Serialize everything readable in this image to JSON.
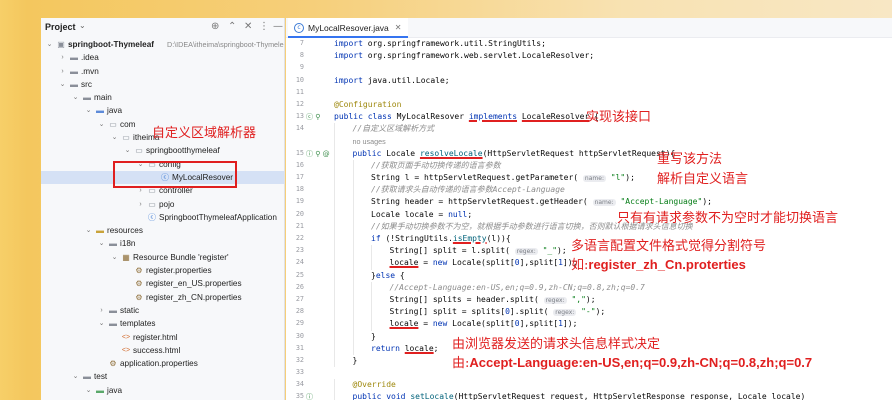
{
  "project_panel": {
    "title": "Project",
    "title_chevron": "chevron-down",
    "tools": [
      "⊕",
      "⌃",
      "✕",
      "⋮",
      "—"
    ],
    "tree": [
      {
        "label": "springboot-Thymeleaf",
        "path": "D:\\IDEA\\itheima\\springboot-Thymeleaf",
        "depth": 0,
        "arrow": "open",
        "icon": "module",
        "bold": true
      },
      {
        "label": ".idea",
        "depth": 1,
        "arrow": "closed",
        "icon": "folder"
      },
      {
        "label": ".mvn",
        "depth": 1,
        "arrow": "closed",
        "icon": "folder"
      },
      {
        "label": "src",
        "depth": 1,
        "arrow": "open",
        "icon": "folder"
      },
      {
        "label": "main",
        "depth": 2,
        "arrow": "open",
        "icon": "folder"
      },
      {
        "label": "java",
        "depth": 3,
        "arrow": "open",
        "icon": "src"
      },
      {
        "label": "com",
        "depth": 4,
        "arrow": "open",
        "icon": "pkg"
      },
      {
        "label": "itheima",
        "depth": 5,
        "arrow": "open",
        "icon": "pkg"
      },
      {
        "label": "springbootthymeleaf",
        "depth": 6,
        "arrow": "open",
        "icon": "pkg"
      },
      {
        "label": "config",
        "depth": 7,
        "arrow": "open",
        "icon": "pkg"
      },
      {
        "label": "MyLocalResover",
        "depth": 8,
        "arrow": "",
        "icon": "cls",
        "selected": true
      },
      {
        "label": "controller",
        "depth": 7,
        "arrow": "closed",
        "icon": "pkg"
      },
      {
        "label": "pojo",
        "depth": 7,
        "arrow": "closed",
        "icon": "pkg"
      },
      {
        "label": "SpringbootThymeleafApplication",
        "depth": 7,
        "arrow": "",
        "icon": "cls"
      },
      {
        "label": "resources",
        "depth": 3,
        "arrow": "open",
        "icon": "res"
      },
      {
        "label": "i18n",
        "depth": 4,
        "arrow": "open",
        "icon": "folder"
      },
      {
        "label": "Resource Bundle 'register'",
        "depth": 5,
        "arrow": "open",
        "icon": "bundle"
      },
      {
        "label": "register.properties",
        "depth": 6,
        "arrow": "",
        "icon": "props"
      },
      {
        "label": "register_en_US.properties",
        "depth": 6,
        "arrow": "",
        "icon": "props"
      },
      {
        "label": "register_zh_CN.properties",
        "depth": 6,
        "arrow": "",
        "icon": "props"
      },
      {
        "label": "static",
        "depth": 4,
        "arrow": "closed",
        "icon": "folder"
      },
      {
        "label": "templates",
        "depth": 4,
        "arrow": "open",
        "icon": "folder"
      },
      {
        "label": "register.html",
        "depth": 5,
        "arrow": "",
        "icon": "html"
      },
      {
        "label": "success.html",
        "depth": 5,
        "arrow": "",
        "icon": "html"
      },
      {
        "label": "application.properties",
        "depth": 4,
        "arrow": "",
        "icon": "props"
      },
      {
        "label": "test",
        "depth": 2,
        "arrow": "open",
        "icon": "folder"
      },
      {
        "label": "java",
        "depth": 3,
        "arrow": "open",
        "icon": "test"
      }
    ]
  },
  "editor": {
    "tab_label": "MyLocalResover.java",
    "lines": [
      {
        "n": "7",
        "ind": 0,
        "html": "<span class='kw'>import</span> org.springframework.util.StringUtils;"
      },
      {
        "n": "8",
        "ind": 0,
        "html": "<span class='kw'>import</span> org.springframework.web.servlet.LocaleResolver;"
      },
      {
        "n": "9",
        "ind": 0,
        "html": ""
      },
      {
        "n": "10",
        "ind": 0,
        "html": "<span class='kw'>import</span> java.util.Locale;"
      },
      {
        "n": "11",
        "ind": 0,
        "html": ""
      },
      {
        "n": "12",
        "ind": 0,
        "html": "<span class='an'>@Configuration</span>"
      },
      {
        "n": "13",
        "ind": 0,
        "gut": "ⓒ ⚲",
        "html": "<span class='kw'>public class</span> MyLocalResover <span class='kw red-ul'>implements</span> <span class='red-ul'>LocaleResolver</span> {"
      },
      {
        "n": "14",
        "ind": 1,
        "html": "<span class='cm'>//自定义区域解析方式</span>"
      },
      {
        "n": "",
        "ind": 1,
        "html": "<span class='uses'>no usages</span>"
      },
      {
        "n": "15",
        "ind": 1,
        "gut": "ⓘ ⚲ @",
        "html": "<span class='kw'>public</span> Locale <span class='meth red-ul'>resolveLocale</span>(HttpServletRequest httpServletRequest){"
      },
      {
        "n": "16",
        "ind": 2,
        "html": "<span class='cm'>//获取页面手动切换传递的语言参数</span>"
      },
      {
        "n": "17",
        "ind": 2,
        "html": "String l = httpServletRequest.getParameter( <span class='hint'>name:</span> <span class='str'>\"l\"</span>);"
      },
      {
        "n": "18",
        "ind": 2,
        "html": "<span class='cm'>//获取请求头自动传递的语言参数Accept-Language</span>"
      },
      {
        "n": "19",
        "ind": 2,
        "html": "String header = httpServletRequest.getHeader( <span class='hint'>name:</span> <span class='str'>\"Accept-Language\"</span>);"
      },
      {
        "n": "20",
        "ind": 2,
        "html": "Locale locale = <span class='kw'>null</span>;"
      },
      {
        "n": "21",
        "ind": 2,
        "html": "<span class='cm'>//如果手动切换参数不为空，就根据手动参数进行语言切换，否则默认根据请求头信息切换</span>"
      },
      {
        "n": "22",
        "ind": 2,
        "html": "<span class='kw'>if</span> (!StringUtils.<span class='meth red-ul'>isEmpty</span>(l)){"
      },
      {
        "n": "23",
        "ind": 3,
        "html": "String[] split = l.split( <span class='hint'>regex:</span> <span class='str'>\"_\"</span>);"
      },
      {
        "n": "24",
        "ind": 3,
        "html": "<span class='red-ul'>locale</span> = <span class='kw'>new</span> Locale(split[<span class='kw'>0</span>],split[<span class='kw'>1</span>]);"
      },
      {
        "n": "25",
        "ind": 2,
        "html": "}<span class='kw'>else</span> {"
      },
      {
        "n": "26",
        "ind": 3,
        "html": "<span class='cm'>//Accept-Language:en-US,en;q=0.9,zh-CN;q=0.8,zh;q=0.7</span>"
      },
      {
        "n": "27",
        "ind": 3,
        "html": "String[] splits = header.split( <span class='hint'>regex:</span> <span class='str'>\",\"</span>);"
      },
      {
        "n": "28",
        "ind": 3,
        "html": "String[] split = splits[<span class='kw'>0</span>].split( <span class='hint'>regex:</span> <span class='str'>\"-\"</span>);"
      },
      {
        "n": "29",
        "ind": 3,
        "html": "<span class='red-ul'>locale</span> = <span class='kw'>new</span> Locale(split[<span class='kw'>0</span>],split[<span class='kw'>1</span>]);"
      },
      {
        "n": "30",
        "ind": 2,
        "html": "}"
      },
      {
        "n": "31",
        "ind": 2,
        "html": "<span class='kw'>return</span> <span class='red-ul'>locale</span>;"
      },
      {
        "n": "32",
        "ind": 1,
        "html": "}"
      },
      {
        "n": "33",
        "ind": 0,
        "html": ""
      },
      {
        "n": "34",
        "ind": 1,
        "html": "<span class='an'>@Override</span>"
      },
      {
        "n": "35",
        "ind": 1,
        "gut": "ⓘ",
        "html": "<span class='kw'>public void</span> <span class='meth'>setLocale</span>(HttpServletRequest <span class='red-ul'>request</span>, HttpServletResponse response, Locale locale)"
      }
    ]
  },
  "annotations": {
    "custom_resolver": "自定义区域解析器",
    "implement_interface": "实现该接口",
    "override_method": "重写该方法",
    "parse_custom_language": "解析自定义语言",
    "switch_only_when_param": "只有有请求参数不为空时才能切换语言",
    "multilang_format": "多语言配置文件格式觉得分割符号",
    "example_prefix": "如:",
    "example_file": "register_zh_Cn.proterties",
    "header_style": "由浏览器发送的请求头信息样式决定",
    "header_prefix": "由:",
    "header_value": "Accept-Language:en-US,en;q=0.9,zh-CN;q=0.8,zh;q=0.7"
  },
  "colors": {
    "annotation_red": "#e01f1f",
    "selection": "#d5e1f5",
    "keyword": "#0033b3",
    "string": "#067d17",
    "comment": "#8c8c8c",
    "annotation_code": "#9e880d"
  }
}
